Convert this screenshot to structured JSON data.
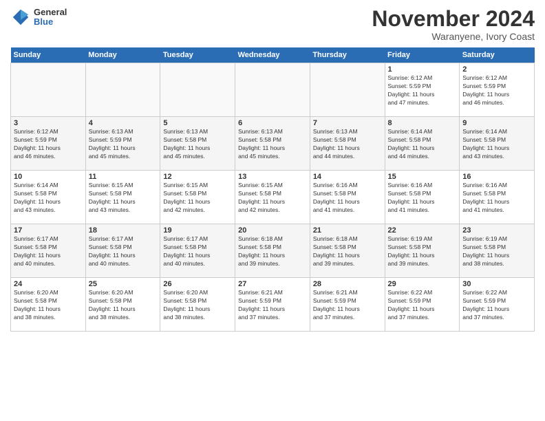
{
  "header": {
    "logo": {
      "general": "General",
      "blue": "Blue"
    },
    "title": "November 2024",
    "subtitle": "Waranyene, Ivory Coast"
  },
  "calendar": {
    "headers": [
      "Sunday",
      "Monday",
      "Tuesday",
      "Wednesday",
      "Thursday",
      "Friday",
      "Saturday"
    ],
    "rows": [
      [
        {
          "day": "",
          "info": ""
        },
        {
          "day": "",
          "info": ""
        },
        {
          "day": "",
          "info": ""
        },
        {
          "day": "",
          "info": ""
        },
        {
          "day": "",
          "info": ""
        },
        {
          "day": "1",
          "info": "Sunrise: 6:12 AM\nSunset: 5:59 PM\nDaylight: 11 hours\nand 47 minutes."
        },
        {
          "day": "2",
          "info": "Sunrise: 6:12 AM\nSunset: 5:59 PM\nDaylight: 11 hours\nand 46 minutes."
        }
      ],
      [
        {
          "day": "3",
          "info": "Sunrise: 6:12 AM\nSunset: 5:59 PM\nDaylight: 11 hours\nand 46 minutes."
        },
        {
          "day": "4",
          "info": "Sunrise: 6:13 AM\nSunset: 5:59 PM\nDaylight: 11 hours\nand 45 minutes."
        },
        {
          "day": "5",
          "info": "Sunrise: 6:13 AM\nSunset: 5:58 PM\nDaylight: 11 hours\nand 45 minutes."
        },
        {
          "day": "6",
          "info": "Sunrise: 6:13 AM\nSunset: 5:58 PM\nDaylight: 11 hours\nand 45 minutes."
        },
        {
          "day": "7",
          "info": "Sunrise: 6:13 AM\nSunset: 5:58 PM\nDaylight: 11 hours\nand 44 minutes."
        },
        {
          "day": "8",
          "info": "Sunrise: 6:14 AM\nSunset: 5:58 PM\nDaylight: 11 hours\nand 44 minutes."
        },
        {
          "day": "9",
          "info": "Sunrise: 6:14 AM\nSunset: 5:58 PM\nDaylight: 11 hours\nand 43 minutes."
        }
      ],
      [
        {
          "day": "10",
          "info": "Sunrise: 6:14 AM\nSunset: 5:58 PM\nDaylight: 11 hours\nand 43 minutes."
        },
        {
          "day": "11",
          "info": "Sunrise: 6:15 AM\nSunset: 5:58 PM\nDaylight: 11 hours\nand 43 minutes."
        },
        {
          "day": "12",
          "info": "Sunrise: 6:15 AM\nSunset: 5:58 PM\nDaylight: 11 hours\nand 42 minutes."
        },
        {
          "day": "13",
          "info": "Sunrise: 6:15 AM\nSunset: 5:58 PM\nDaylight: 11 hours\nand 42 minutes."
        },
        {
          "day": "14",
          "info": "Sunrise: 6:16 AM\nSunset: 5:58 PM\nDaylight: 11 hours\nand 41 minutes."
        },
        {
          "day": "15",
          "info": "Sunrise: 6:16 AM\nSunset: 5:58 PM\nDaylight: 11 hours\nand 41 minutes."
        },
        {
          "day": "16",
          "info": "Sunrise: 6:16 AM\nSunset: 5:58 PM\nDaylight: 11 hours\nand 41 minutes."
        }
      ],
      [
        {
          "day": "17",
          "info": "Sunrise: 6:17 AM\nSunset: 5:58 PM\nDaylight: 11 hours\nand 40 minutes."
        },
        {
          "day": "18",
          "info": "Sunrise: 6:17 AM\nSunset: 5:58 PM\nDaylight: 11 hours\nand 40 minutes."
        },
        {
          "day": "19",
          "info": "Sunrise: 6:17 AM\nSunset: 5:58 PM\nDaylight: 11 hours\nand 40 minutes."
        },
        {
          "day": "20",
          "info": "Sunrise: 6:18 AM\nSunset: 5:58 PM\nDaylight: 11 hours\nand 39 minutes."
        },
        {
          "day": "21",
          "info": "Sunrise: 6:18 AM\nSunset: 5:58 PM\nDaylight: 11 hours\nand 39 minutes."
        },
        {
          "day": "22",
          "info": "Sunrise: 6:19 AM\nSunset: 5:58 PM\nDaylight: 11 hours\nand 39 minutes."
        },
        {
          "day": "23",
          "info": "Sunrise: 6:19 AM\nSunset: 5:58 PM\nDaylight: 11 hours\nand 38 minutes."
        }
      ],
      [
        {
          "day": "24",
          "info": "Sunrise: 6:20 AM\nSunset: 5:58 PM\nDaylight: 11 hours\nand 38 minutes."
        },
        {
          "day": "25",
          "info": "Sunrise: 6:20 AM\nSunset: 5:58 PM\nDaylight: 11 hours\nand 38 minutes."
        },
        {
          "day": "26",
          "info": "Sunrise: 6:20 AM\nSunset: 5:58 PM\nDaylight: 11 hours\nand 38 minutes."
        },
        {
          "day": "27",
          "info": "Sunrise: 6:21 AM\nSunset: 5:59 PM\nDaylight: 11 hours\nand 37 minutes."
        },
        {
          "day": "28",
          "info": "Sunrise: 6:21 AM\nSunset: 5:59 PM\nDaylight: 11 hours\nand 37 minutes."
        },
        {
          "day": "29",
          "info": "Sunrise: 6:22 AM\nSunset: 5:59 PM\nDaylight: 11 hours\nand 37 minutes."
        },
        {
          "day": "30",
          "info": "Sunrise: 6:22 AM\nSunset: 5:59 PM\nDaylight: 11 hours\nand 37 minutes."
        }
      ]
    ]
  }
}
